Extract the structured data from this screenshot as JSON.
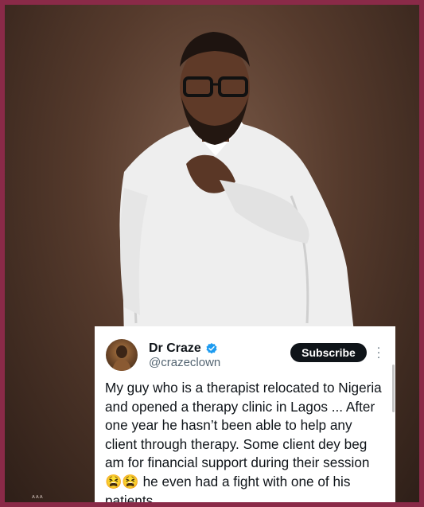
{
  "tweet": {
    "author_name": "Dr Craze",
    "handle": "@crazeclown",
    "verified": true,
    "subscribe_label": "Subscribe",
    "more_icon": "more-vertical-icon",
    "text": "My guy who is a therapist relocated to Nigeria and opened a  therapy clinic  in Lagos ... After one year he hasn’t been able to help any client through therapy. Some client dey beg am for financial support during their session 😫😫 he even had a fight with one of his patients"
  },
  "photo": {
    "watermark": "ᴬᴬᴬ"
  },
  "colors": {
    "frame_border": "#8a2a48",
    "verified_blue": "#1d9bf0",
    "subscribe_bg": "#0f1419"
  }
}
